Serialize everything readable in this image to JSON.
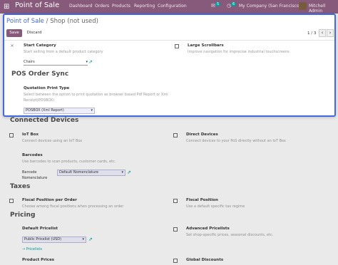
{
  "navbar": {
    "brand": "Point of Sale",
    "menu": [
      "Dashboard",
      "Orders",
      "Products",
      "Reporting",
      "Configuration"
    ],
    "chat_count": "5",
    "activity_count": "6",
    "company": "My Company (San Francisco)",
    "user": "Mitchell Admin",
    "apps_icon": "grid-icon"
  },
  "panel": {
    "breadcrumb_root": "Point of Sale",
    "breadcrumb_sep": "/",
    "breadcrumb_current": "Shop (not used)",
    "save_label": "Save",
    "discard_label": "Discard",
    "pager": "1 / 3",
    "prev": "‹",
    "next": "›",
    "start_category": {
      "title": "Start Category",
      "help": "Start selling from a default product category",
      "value": "Chairs"
    },
    "large_scrollbars": {
      "title": "Large Scrollbars",
      "help": "Improve navigation for imprecise industrial touchscreens"
    },
    "sync_title": "POS Order Sync",
    "quotation_print": {
      "title": "Quotation Print Type",
      "help_line1": "Select between the option to print quotation as browser based Pdf Report or Xml",
      "help_line2": "Receipt(POSBOX)",
      "value": "POSBOX (Xml Report)"
    }
  },
  "page": {
    "connected_devices": {
      "title": "Connected Devices",
      "iot_title": "IoT Box",
      "iot_help": "Connect devices using an IoT Box",
      "direct_title": "Direct Devices",
      "direct_help": "Connect devices to your PoS directly without an IoT Box",
      "barcodes_title": "Barcodes",
      "barcodes_help": "Use barcodes to scan products, customer cards, etc.",
      "barcode_label_1": "Barcode",
      "barcode_label_2": "Nomenclature",
      "barcode_value": "Default Nomenclature"
    },
    "taxes": {
      "title": "Taxes",
      "fiscal_order_title": "Fiscal Position per Order",
      "fiscal_order_help": "Choose among fiscal positions when processing an order",
      "fiscal_title": "Fiscal Position",
      "fiscal_help": "Use a default specific tax regime"
    },
    "pricing": {
      "title": "Pricing",
      "default_pricelist_title": "Default Pricelist",
      "default_pricelist_value": "Public Pricelist (USD)",
      "pricelists_link": "→ Pricelists",
      "advanced_title": "Advanced Pricelists",
      "advanced_help": "Set shop-specific prices, seasonal discounts, etc.",
      "product_prices_title": "Product Prices",
      "global_discounts_title": "Global Discounts"
    }
  },
  "colors": {
    "brand": "#875a7b",
    "accent": "#00a09d",
    "focus": "#4169e1"
  }
}
